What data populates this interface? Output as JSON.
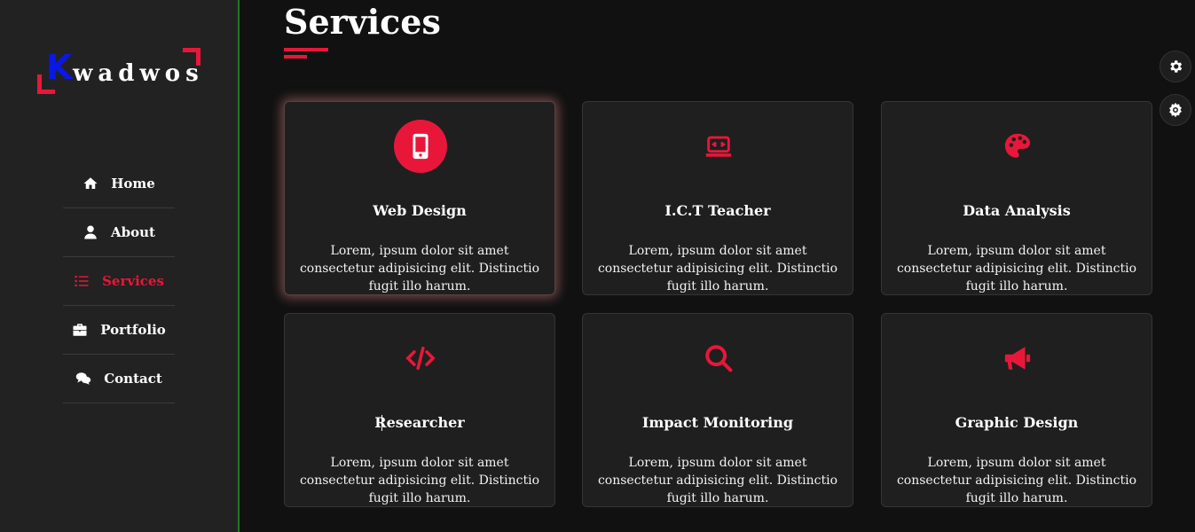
{
  "logo": {
    "first_letter": "K",
    "rest": "wadwos"
  },
  "nav": {
    "items": [
      {
        "label": "Home",
        "icon": "home-icon"
      },
      {
        "label": "About",
        "icon": "user-icon"
      },
      {
        "label": "Services",
        "icon": "list-icon",
        "active": true
      },
      {
        "label": "Portfolio",
        "icon": "briefcase-icon"
      },
      {
        "label": "Contact",
        "icon": "comments-icon"
      }
    ]
  },
  "page": {
    "title": "Services"
  },
  "services": [
    {
      "title": "Web Design",
      "icon": "mobile-icon",
      "desc": "Lorem, ipsum dolor sit amet consectetur adipisicing elit. Distinctio fugit illo harum."
    },
    {
      "title": "I.C.T Teacher",
      "icon": "laptop-code-icon",
      "desc": "Lorem, ipsum dolor sit amet consectetur adipisicing elit. Distinctio fugit illo harum."
    },
    {
      "title": "Data Analysis",
      "icon": "palette-icon",
      "desc": "Lorem, ipsum dolor sit amet consectetur adipisicing elit. Distinctio fugit illo harum."
    },
    {
      "title": "Researcher",
      "icon": "code-icon",
      "desc": "Lorem, ipsum dolor sit amet consectetur adipisicing elit. Distinctio fugit illo harum."
    },
    {
      "title": "Impact Monitoring",
      "icon": "search-icon",
      "desc": "Lorem, ipsum dolor sit amet consectetur adipisicing elit. Distinctio fugit illo harum."
    },
    {
      "title": "Graphic Design",
      "icon": "bullhorn-icon",
      "desc": "Lorem, ipsum dolor sit amet consectetur adipisicing elit. Distinctio fugit illo harum."
    }
  ],
  "colors": {
    "accent": "#e8173a",
    "logo_k": "#0a18e6",
    "background": "#111111",
    "sidebar": "#222222",
    "sidebar_border": "#1f7a1f"
  },
  "floating_buttons": [
    {
      "icon": "gear-icon"
    },
    {
      "icon": "cog-icon"
    }
  ]
}
